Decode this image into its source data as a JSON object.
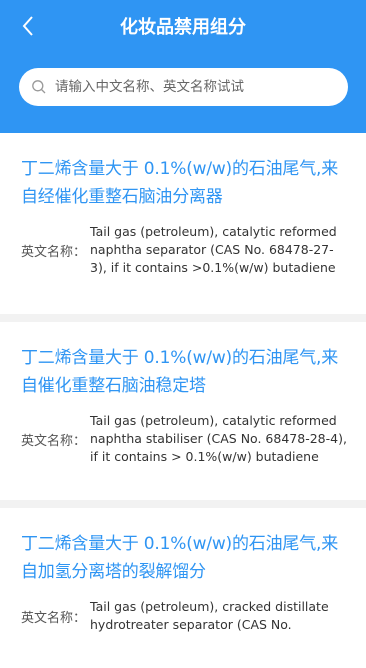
{
  "header": {
    "title": "化妆品禁用组分",
    "back_icon": "chevron-left-icon"
  },
  "search": {
    "placeholder": "请输入中文名称、英文名称试试",
    "value": "",
    "icon": "search-icon"
  },
  "items": [
    {
      "title": "丁二烯含量大于 0.1%(w/w)的石油尾气,来自经催化重整石脑油分离器",
      "label": "英文名称：",
      "value": "Tail gas (petroleum), catalytic reformed naphtha separator (CAS No. 68478-27-3), if it contains >0.1%(w/w) butadiene"
    },
    {
      "title": "丁二烯含量大于 0.1%(w/w)的石油尾气,来自催化重整石脑油稳定塔",
      "label": "英文名称：",
      "value": "Tail gas (petroleum), catalytic reformed naphtha stabiliser (CAS No. 68478-28-4), if it contains > 0.1%(w/w) butadiene"
    },
    {
      "title": "丁二烯含量大于 0.1%(w/w)的石油尾气,来自加氢分离塔的裂解馏分",
      "label": "英文名称：",
      "value": "Tail gas (petroleum), cracked distillate hydrotreater separator (CAS No."
    }
  ],
  "colors": {
    "accent": "#2f95f3",
    "background": "#f2f2f2"
  }
}
